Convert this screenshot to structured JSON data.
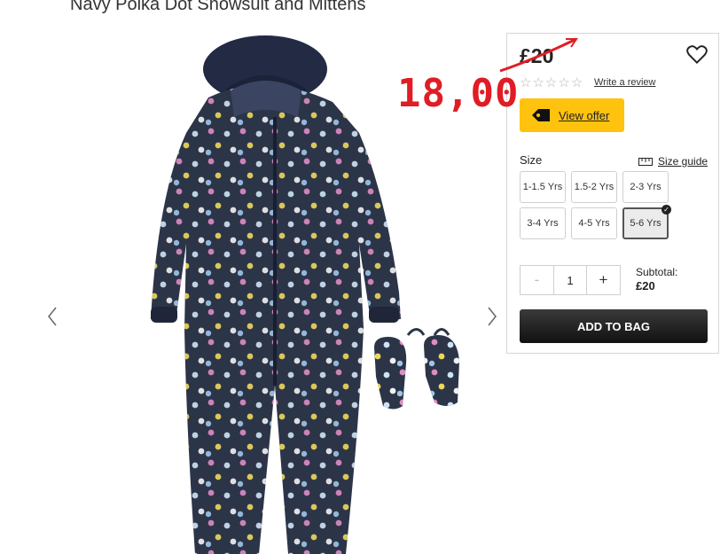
{
  "product": {
    "title": "Navy Polka Dot Snowsuit and Mittens",
    "price": "£20",
    "review_link": "Write a review",
    "offer_label": "View offer",
    "size_label": "Size",
    "size_guide": "Size guide",
    "sizes": [
      "1-1.5 Yrs",
      "1.5-2 Yrs",
      "2-3 Yrs",
      "3-4 Yrs",
      "4-5 Yrs",
      "5-6 Yrs"
    ],
    "selected_size": "5-6 Yrs",
    "quantity": "1",
    "qty_minus": "-",
    "qty_plus": "+",
    "subtotal_label": "Subtotal:",
    "subtotal_value": "£20",
    "add_to_bag": "ADD TO BAG",
    "rating_stars": 0
  },
  "annotation": {
    "handwritten_price": "18,00",
    "color": "#e01d24"
  },
  "colors": {
    "offer_yellow": "#ffc20e",
    "button_dark": "#1a1a1a",
    "snowsuit_navy": "#2c3448"
  }
}
